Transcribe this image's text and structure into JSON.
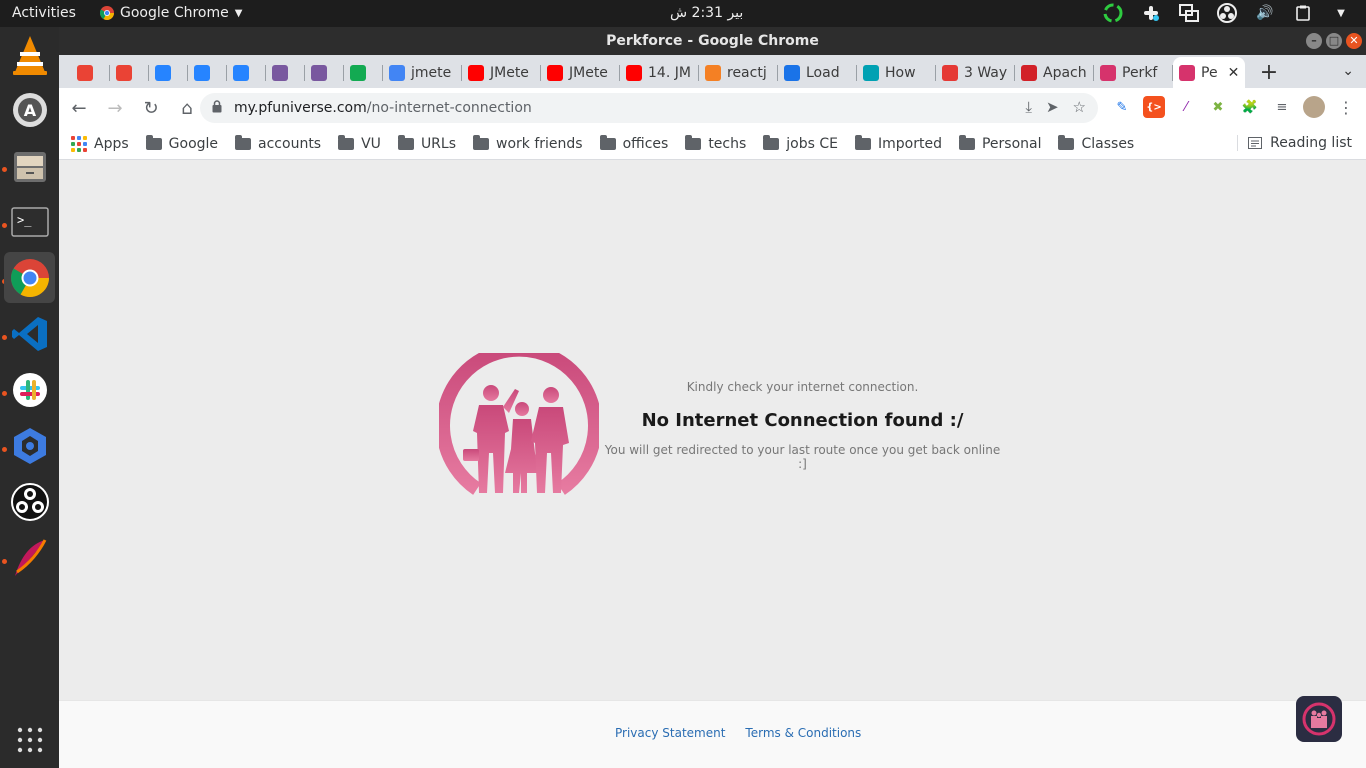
{
  "system": {
    "activities": "Activities",
    "app_name": "Google Chrome",
    "clock": "بير 2:31 ش"
  },
  "window": {
    "title": "Perkforce - Google Chrome"
  },
  "tabs": [
    {
      "label": "",
      "icon": "gmail-icon",
      "color": "#ea4335"
    },
    {
      "label": "",
      "icon": "gmail-icon",
      "color": "#ea4335"
    },
    {
      "label": "",
      "icon": "jira-icon",
      "color": "#2684ff"
    },
    {
      "label": "",
      "icon": "bitbucket-icon",
      "color": "#2684ff"
    },
    {
      "label": "",
      "icon": "bitbucket-icon",
      "color": "#2684ff"
    },
    {
      "label": "",
      "icon": "heroku-icon",
      "color": "#79589f"
    },
    {
      "label": "",
      "icon": "heroku-icon",
      "color": "#79589f"
    },
    {
      "label": "",
      "icon": "mongodb-icon",
      "color": "#13aa52"
    },
    {
      "label": "jmete",
      "icon": "google-icon",
      "color": "#4285f4"
    },
    {
      "label": "JMete",
      "icon": "youtube-icon",
      "color": "#ff0000"
    },
    {
      "label": "JMete",
      "icon": "youtube-icon",
      "color": "#ff0000"
    },
    {
      "label": "14. JM",
      "icon": "youtube-icon",
      "color": "#ff0000"
    },
    {
      "label": "reactj",
      "icon": "stackoverflow-icon",
      "color": "#f48024"
    },
    {
      "label": "Load",
      "icon": "chart-icon",
      "color": "#1a73e8"
    },
    {
      "label": "How",
      "icon": "refresh-circle-icon",
      "color": "#00a1b3"
    },
    {
      "label": "3 Way",
      "icon": "brand-b-icon",
      "color": "#e53935"
    },
    {
      "label": "Apach",
      "icon": "apache-feather-icon",
      "color": "#d22128"
    },
    {
      "label": "Perkf",
      "icon": "perkforce-icon",
      "color": "#d6336c"
    },
    {
      "label": "Pe",
      "icon": "perkforce-icon",
      "color": "#d6336c",
      "active": true
    }
  ],
  "toolbar": {
    "url_host": "my.pfuniverse.com",
    "url_path": "/no-internet-connection"
  },
  "bookmarks": {
    "apps": "Apps",
    "items": [
      "Google",
      "accounts",
      "VU",
      "URLs",
      "work friends",
      "offices",
      "techs",
      "jobs CE",
      "Imported",
      "Personal",
      "Classes"
    ],
    "reading_list": "Reading list"
  },
  "page": {
    "hint": "Kindly check your internet connection.",
    "title": "No Internet Connection found :/",
    "subtitle": "You will get redirected to your last route once you get back online :]",
    "footer_privacy": "Privacy Statement",
    "footer_terms": "Terms & Conditions"
  },
  "colors": {
    "brand": "#d6336c",
    "link": "#2a6db3",
    "ubuntu_orange": "#e95420"
  }
}
